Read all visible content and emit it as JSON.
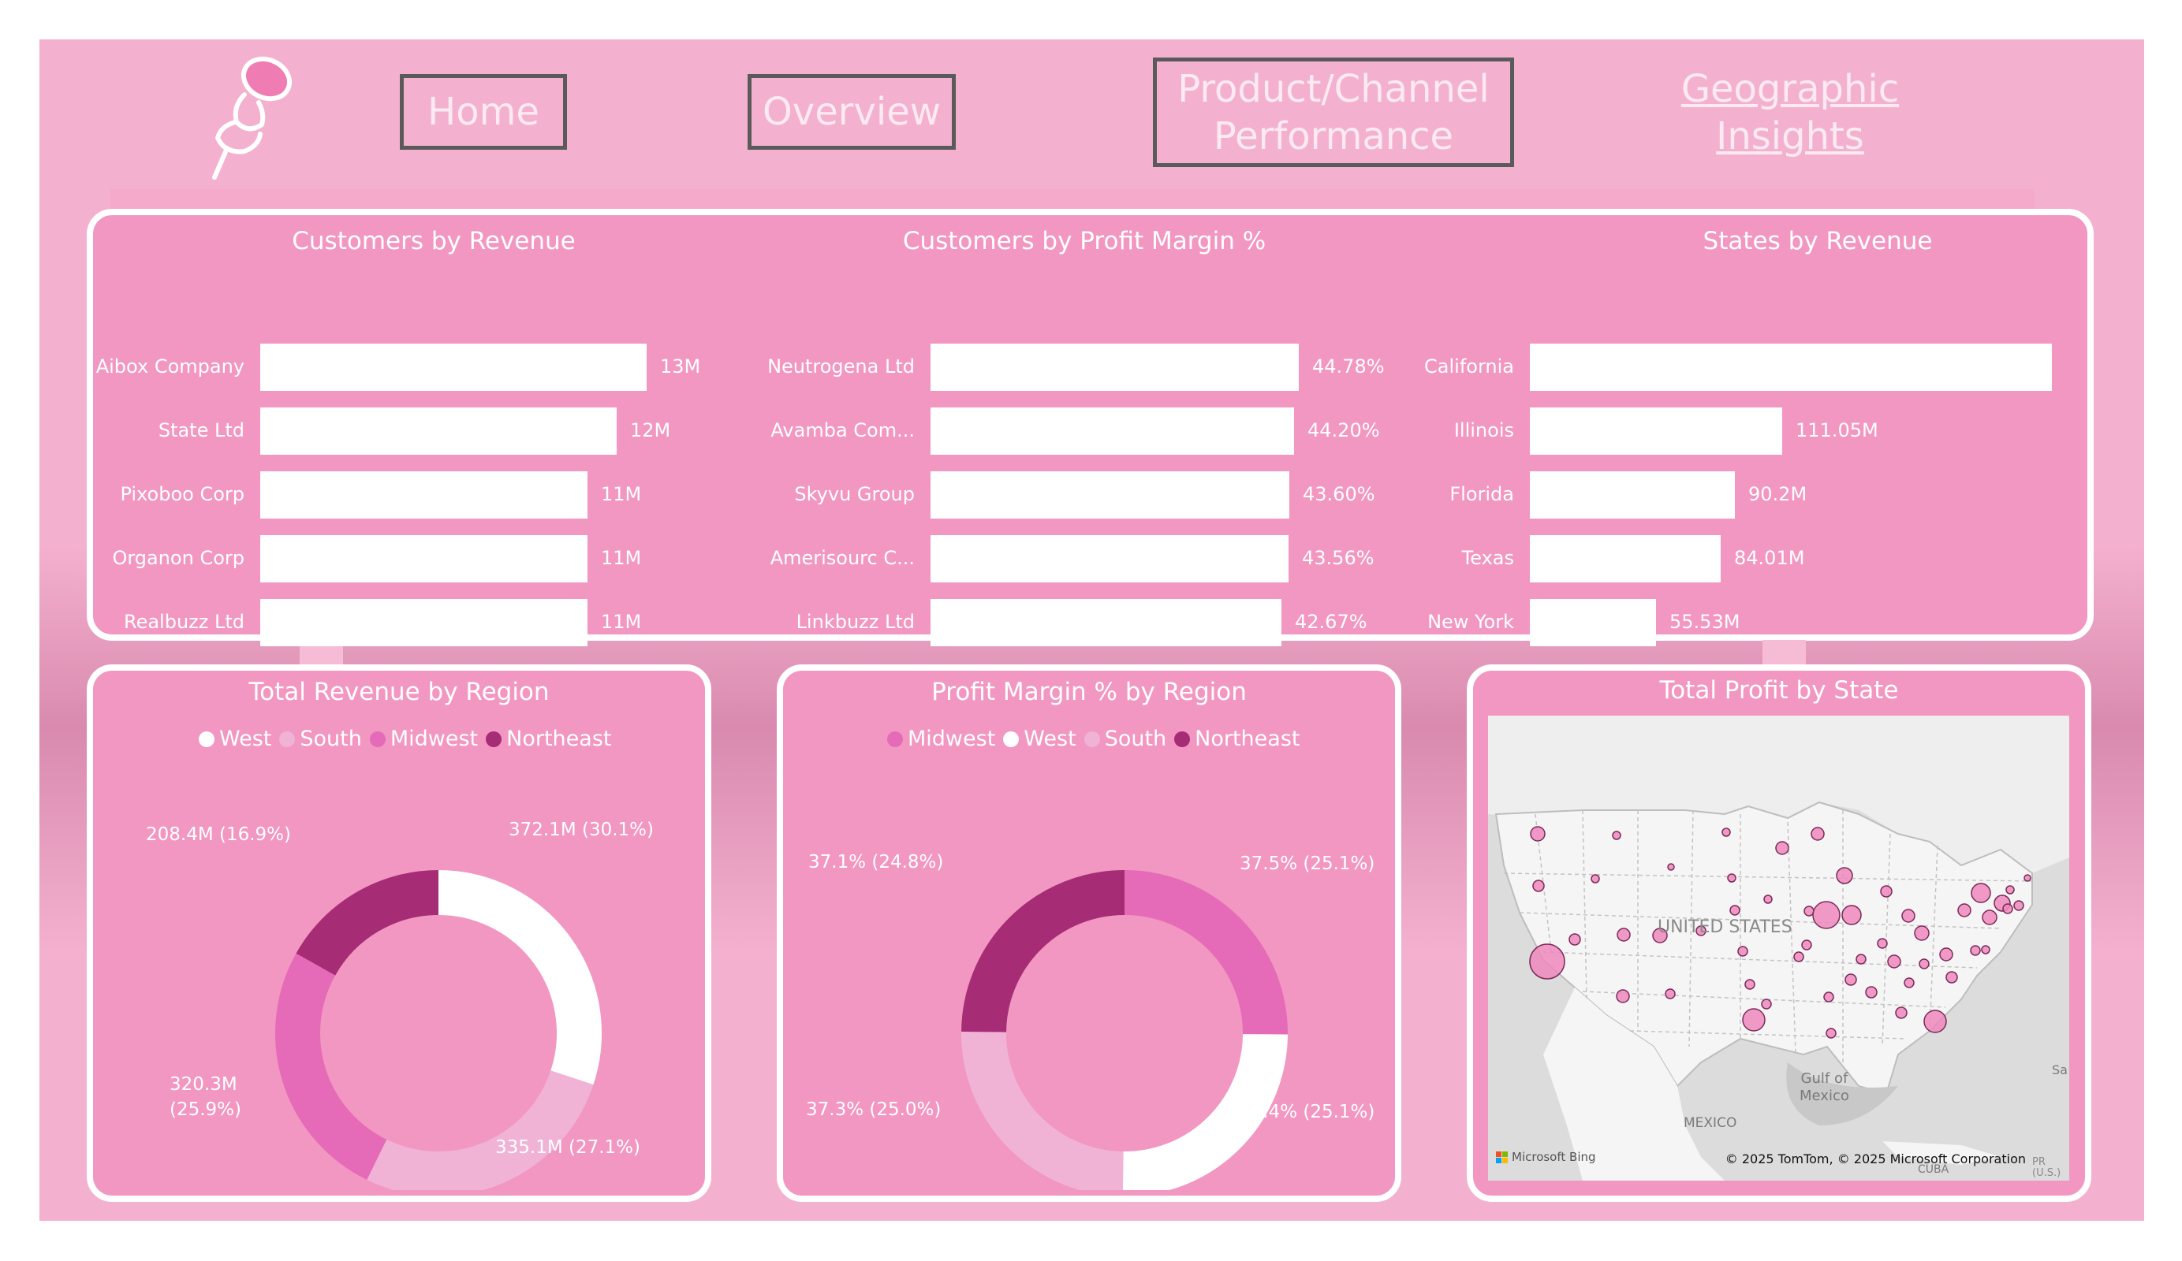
{
  "nav": {
    "home": "Home",
    "overview": "Overview",
    "product_channel_line1": "Product/Channel",
    "product_channel_line2": "Performance",
    "geographic_line1": "Geographic",
    "geographic_line2": "Insights"
  },
  "logo": {
    "icon": "pushpin-icon"
  },
  "top_charts": {
    "customers_revenue": {
      "title": "Customers by Revenue",
      "chart_data": {
        "type": "bar",
        "categories": [
          "Aibox Company",
          "State Ltd",
          "Pixoboo Corp",
          "Organon Corp",
          "Realbuzz Ltd"
        ],
        "values": [
          13,
          12,
          11,
          11,
          11
        ],
        "labels": [
          "13M",
          "12M",
          "11M",
          "11M",
          "11M"
        ]
      }
    },
    "customers_margin": {
      "title": "Customers by Profit Margin %",
      "chart_data": {
        "type": "bar",
        "categories": [
          "Neutrogena Ltd",
          "Avamba Com...",
          "Skyvu Group",
          "Amerisourc C...",
          "Linkbuzz Ltd"
        ],
        "values": [
          44.78,
          44.2,
          43.6,
          43.56,
          42.67
        ],
        "labels": [
          "44.78%",
          "44.20%",
          "43.60%",
          "43.56%",
          "42.67%"
        ]
      }
    },
    "states_revenue": {
      "title": "States by Revenue",
      "chart_data": {
        "type": "bar",
        "categories": [
          "California",
          "Illinois",
          "Florida",
          "Texas",
          "New York"
        ],
        "values": [
          230,
          111.05,
          90.2,
          84.01,
          55.53
        ],
        "labels": [
          "",
          "111.05M",
          "90.2M",
          "84.01M",
          "55.53M"
        ]
      }
    }
  },
  "revenue_region": {
    "title": "Total Revenue by Region",
    "legend": [
      {
        "name": "West",
        "color": "#ffffff"
      },
      {
        "name": "South",
        "color": "#f0b3d6"
      },
      {
        "name": "Midwest",
        "color": "#e56bb8"
      },
      {
        "name": "Northeast",
        "color": "#a52c75"
      }
    ],
    "chart_data": {
      "type": "pie",
      "categories": [
        "West",
        "South",
        "Midwest",
        "Northeast"
      ],
      "values": [
        372.1,
        335.1,
        320.3,
        208.4
      ],
      "percent": [
        30.1,
        27.1,
        25.9,
        16.9
      ],
      "colors": [
        "#ffffff",
        "#f0b3d6",
        "#e56bb8",
        "#a52c75"
      ]
    },
    "labels": {
      "west": "372.1M (30.1%)",
      "south": "335.1M (27.1%)",
      "midwest_1": "320.3M",
      "midwest_2": "(25.9%)",
      "northeast": "208.4M (16.9%)"
    }
  },
  "margin_region": {
    "title": "Profit Margin % by Region",
    "legend": [
      {
        "name": "Midwest",
        "color": "#e56bb8"
      },
      {
        "name": "West",
        "color": "#ffffff"
      },
      {
        "name": "South",
        "color": "#f0b3d6"
      },
      {
        "name": "Northeast",
        "color": "#a52c75"
      }
    ],
    "chart_data": {
      "type": "pie",
      "categories": [
        "Midwest",
        "West",
        "South",
        "Northeast"
      ],
      "values": [
        37.5,
        37.4,
        37.3,
        37.1
      ],
      "percent": [
        25.1,
        25.1,
        25.0,
        24.8
      ],
      "colors": [
        "#e56bb8",
        "#ffffff",
        "#f0b3d6",
        "#a52c75"
      ]
    },
    "labels": {
      "midwest": "37.5% (25.1%)",
      "west": "37.4% (25.1%)",
      "south": "37.3% (25.0%)",
      "northeast": "37.1% (24.8%)"
    }
  },
  "profit_state": {
    "title": "Total Profit by State",
    "map_labels": {
      "country": "UNITED STATES",
      "gulf_1": "Gulf of",
      "gulf_2": "Mexico",
      "mexico": "MEXICO",
      "cuba": "CUBA",
      "sa": "Sa",
      "pr_1": "PR",
      "pr_2": "(U.S.)",
      "bing": "Microsoft Bing",
      "copyright": "© 2025 TomTom, © 2025 Microsoft Corporation"
    }
  }
}
